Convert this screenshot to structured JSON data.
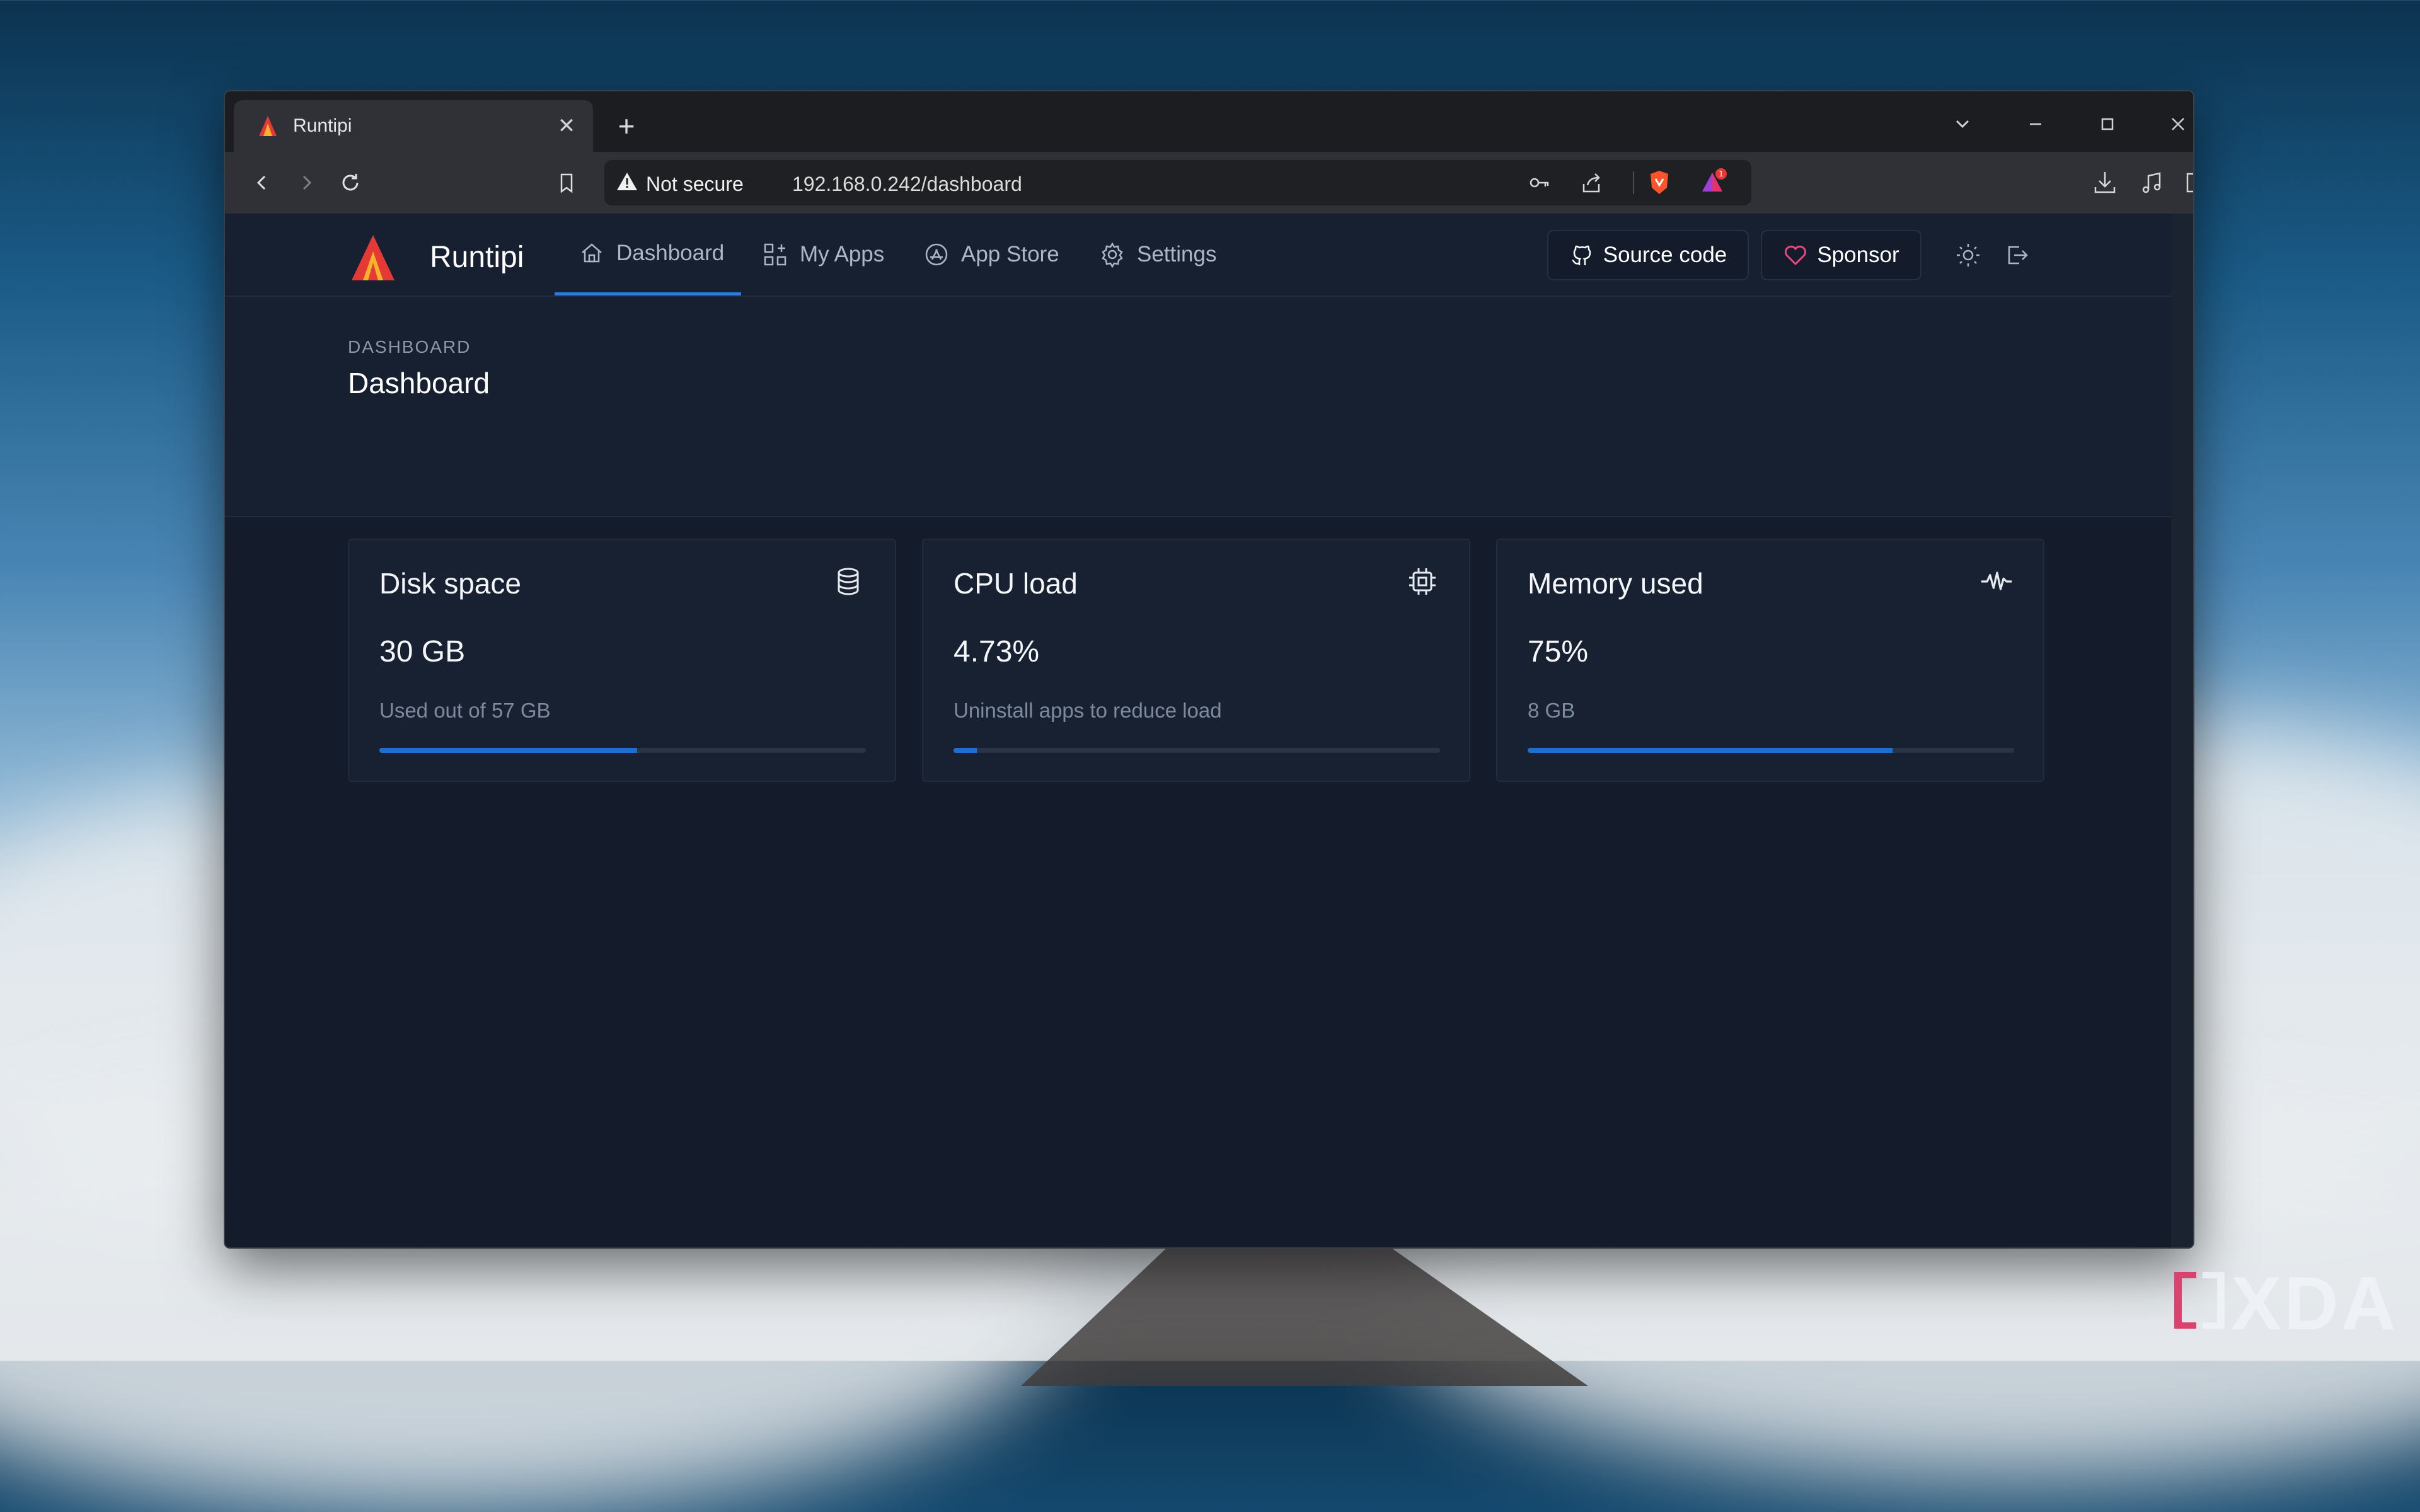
{
  "browser": {
    "tab": {
      "title": "Runtipi"
    },
    "address": {
      "security_label": "Not secure",
      "url": "192.168.0.242/dashboard"
    },
    "notification_count": "1"
  },
  "app": {
    "brand": "Runtipi",
    "nav": [
      {
        "label": "Dashboard",
        "icon": "home-icon",
        "active": true
      },
      {
        "label": "My Apps",
        "icon": "apps-icon",
        "active": false
      },
      {
        "label": "App Store",
        "icon": "app-store-icon",
        "active": false
      },
      {
        "label": "Settings",
        "icon": "gear-icon",
        "active": false
      }
    ],
    "source_code_label": "Source code",
    "sponsor_label": "Sponsor"
  },
  "page": {
    "pretitle": "DASHBOARD",
    "title": "Dashboard"
  },
  "cards": [
    {
      "title": "Disk space",
      "value": "30 GB",
      "subtitle": "Used out of 57 GB",
      "progress": 0.53,
      "icon": "database-icon"
    },
    {
      "title": "CPU load",
      "value": "4.73%",
      "subtitle": "Uninstall apps to reduce load",
      "progress": 0.0473,
      "icon": "cpu-icon"
    },
    {
      "title": "Memory used",
      "value": "75%",
      "subtitle": "8 GB",
      "progress": 0.75,
      "icon": "activity-icon"
    }
  ],
  "colors": {
    "accent": "#1f6fcf",
    "page_bg": "#141c2b",
    "brand_red": "#e53935",
    "sponsor_pink": "#e8467c"
  },
  "watermark": "XDA"
}
